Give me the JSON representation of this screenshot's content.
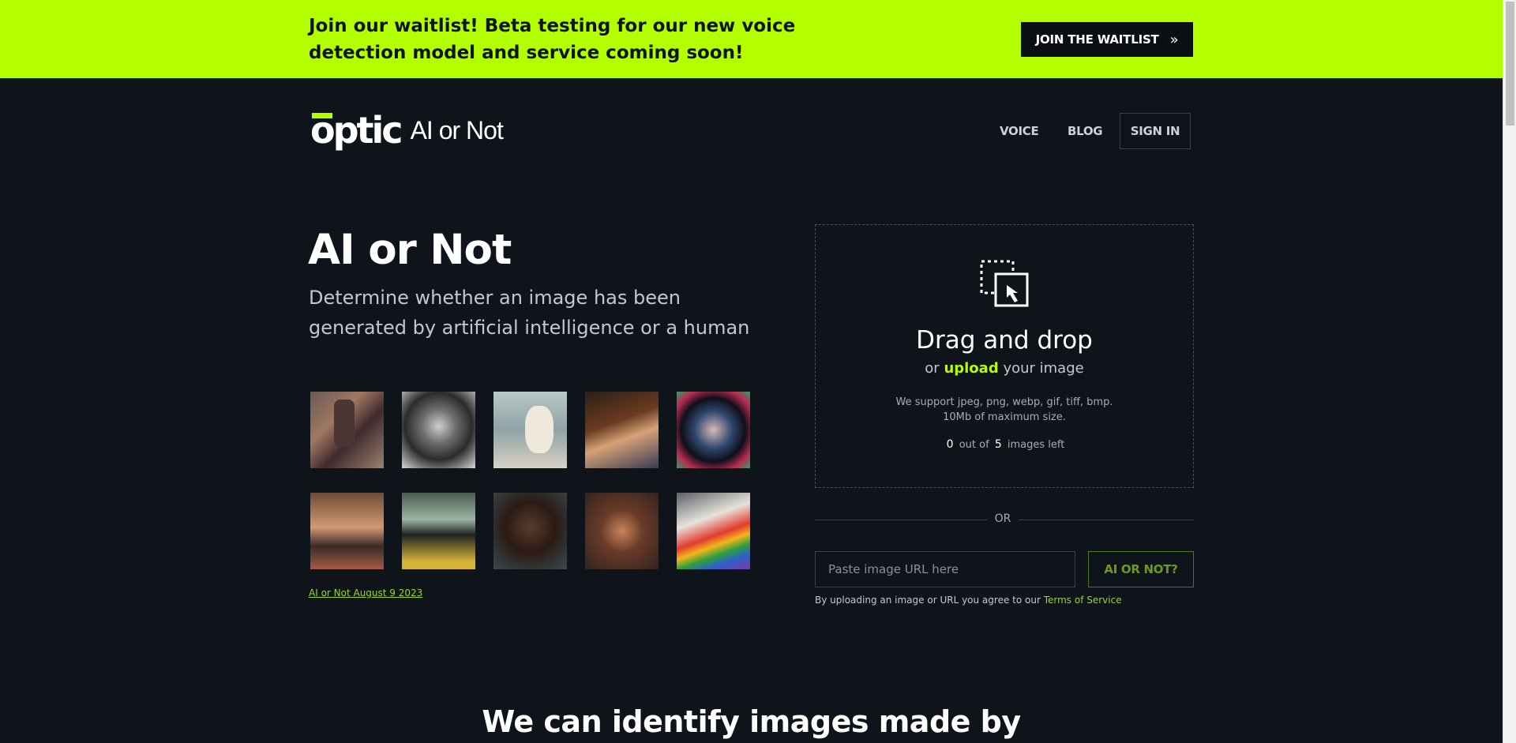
{
  "banner": {
    "text": "Join our waitlist! Beta testing for our new voice detection model and service coming soon!",
    "button_label": "JOIN THE WAITLIST",
    "button_icon": "»"
  },
  "header": {
    "logo_text": "optic",
    "logo_sub": "AI or Not",
    "nav": {
      "voice": "VOICE",
      "blog": "BLOG",
      "signin": "SIGN IN"
    }
  },
  "hero": {
    "title": "AI or Not",
    "description": "Determine whether an image has been generated by artificial intelligence or a human",
    "date_link": "AI or Not August 9 2023"
  },
  "upload": {
    "title": "Drag and drop",
    "sub_prefix": "or",
    "sub_link": "upload",
    "sub_suffix": "your image",
    "support_line1": "We support jpeg, png, webp, gif, tiff, bmp.",
    "support_line2": "10Mb of maximum size.",
    "count_used": "0",
    "count_mid": "out of",
    "count_total": "5",
    "count_suffix": "images left",
    "or_label": "OR",
    "url_placeholder": "Paste image URL here",
    "submit_label": "AI OR NOT?",
    "terms_prefix": "By uploading an image or URL you agree to our",
    "terms_link": "Terms of Service"
  },
  "section": {
    "heading": "We can identify images made by"
  },
  "colors": {
    "accent": "#b3ff00",
    "background": "#0f141b"
  }
}
